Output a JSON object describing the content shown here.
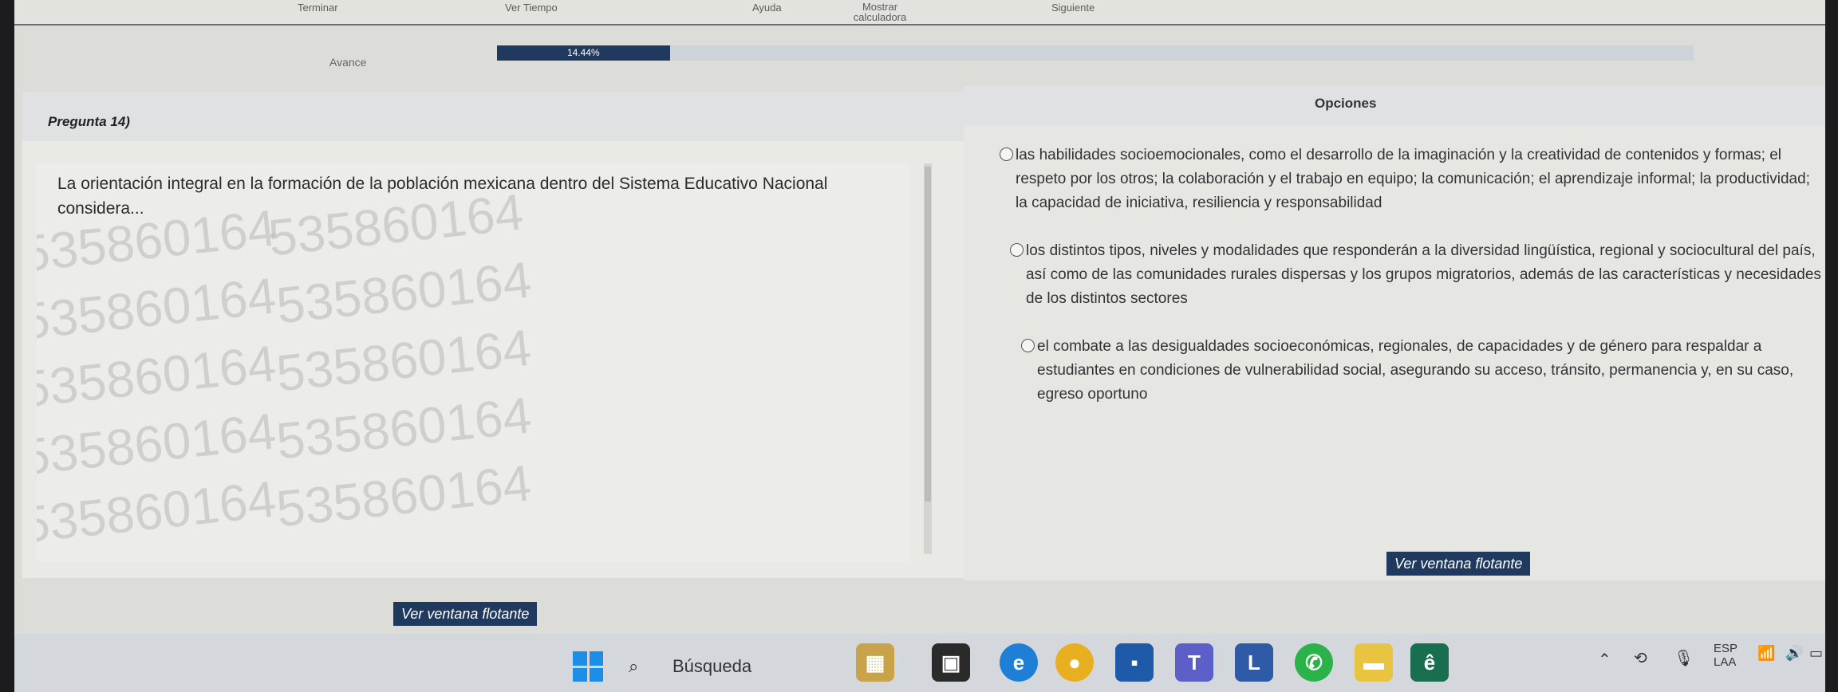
{
  "menu": {
    "items": [
      "Terminar",
      "Ver Tiempo",
      "Ayuda",
      "Mostrar calculadora",
      "Siguiente"
    ]
  },
  "progress": {
    "label": "Avance",
    "percent_text": "14.44%",
    "value": 14.44
  },
  "question": {
    "number": "Pregunta 14)",
    "text": "La orientación integral en la formación de la población mexicana dentro del Sistema Educativo Nacional considera...",
    "watermark": "535860164"
  },
  "options": {
    "title": "Opciones",
    "items": [
      {
        "text": "las habilidades socioemocionales, como el desarrollo de la imaginación y la creatividad de contenidos y formas; el respeto por los otros; la colaboración y el trabajo en equipo; la comunicación; el aprendizaje informal; la productividad; la capacidad de iniciativa, resiliencia y responsabilidad"
      },
      {
        "text": "los distintos tipos, niveles y modalidades que responderán a la diversidad lingüística, regional y sociocultural del país, así como de las comunidades rurales dispersas y los grupos migratorios, además de las características y necesidades de los distintos sectores"
      },
      {
        "text": "el combate a las desigualdades socioeconómicas, regionales, de capacidades y de género para respaldar a estudiantes en condiciones de vulnerabilidad social, asegurando su acceso, tránsito, permanencia y, en su caso, egreso oportuno"
      }
    ]
  },
  "buttons": {
    "floating_window": "Ver ventana flotante"
  },
  "taskbar": {
    "search_placeholder": "Búsqueda",
    "lang_top": "ESP",
    "lang_bottom": "LAA"
  },
  "colors": {
    "accent": "#1f3a5e",
    "windows_blue": "#1b8fe8"
  }
}
